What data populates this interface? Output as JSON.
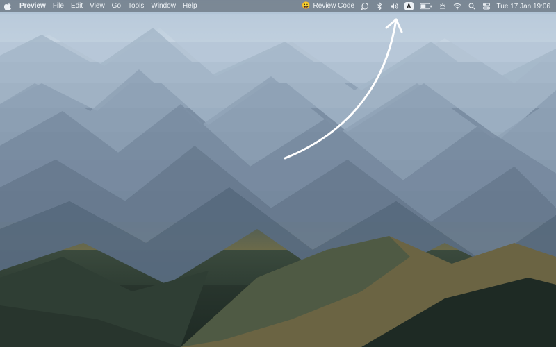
{
  "menubar": {
    "app_name": "Preview",
    "items": [
      "File",
      "Edit",
      "View",
      "Go",
      "Tools",
      "Window",
      "Help"
    ]
  },
  "status": {
    "review": {
      "emoji": "😀",
      "label": "Review Code"
    },
    "input_source": "A",
    "clock": "Tue 17 Jan  19:06"
  },
  "icons": {
    "apple": "apple-icon",
    "message": "message-icon",
    "bluetooth": "bluetooth-icon",
    "volume": "volume-icon",
    "battery": "battery-icon",
    "wifi": "wifi-icon",
    "search": "search-icon",
    "control_center": "control-center-icon"
  }
}
